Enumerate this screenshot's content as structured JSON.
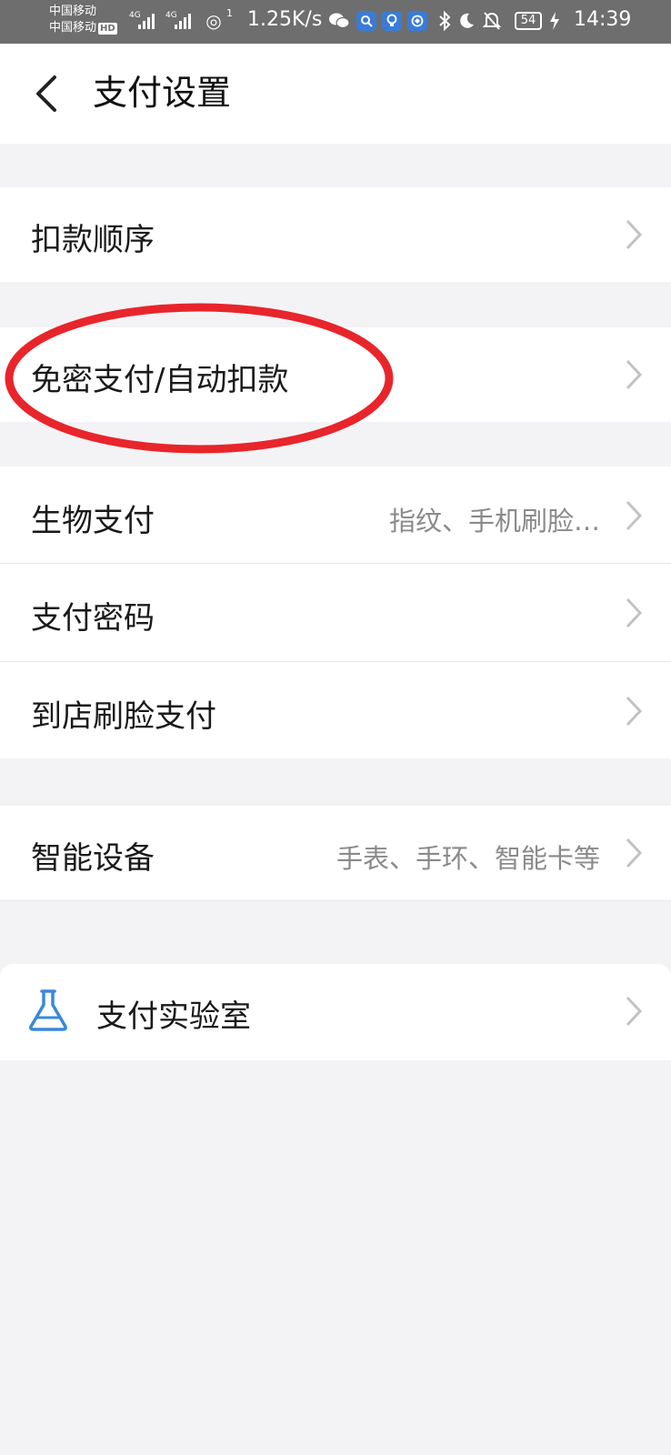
{
  "status_bar": {
    "carrier_1": "中国移动",
    "carrier_2": "中国移动",
    "hd": "HD",
    "net_1": "4G",
    "net_2": "4G",
    "hotspot_count": "1",
    "speed": "1.25K/s",
    "battery": "54",
    "time": "14:39"
  },
  "header": {
    "title": "支付设置"
  },
  "settings": {
    "deduction_order": {
      "label": "扣款顺序"
    },
    "password_free": {
      "label": "免密支付/自动扣款"
    },
    "biometric": {
      "label": "生物支付",
      "value": "指纹、手机刷脸…"
    },
    "pay_password": {
      "label": "支付密码"
    },
    "face_pay_store": {
      "label": "到店刷脸支付"
    },
    "smart_devices": {
      "label": "智能设备",
      "value": "手表、手环、智能卡等"
    },
    "pay_lab": {
      "label": "支付实验室"
    }
  },
  "colors": {
    "highlight": "#e8252b",
    "lab_icon": "#3a88d8",
    "page_bg": "#f3f3f5"
  }
}
